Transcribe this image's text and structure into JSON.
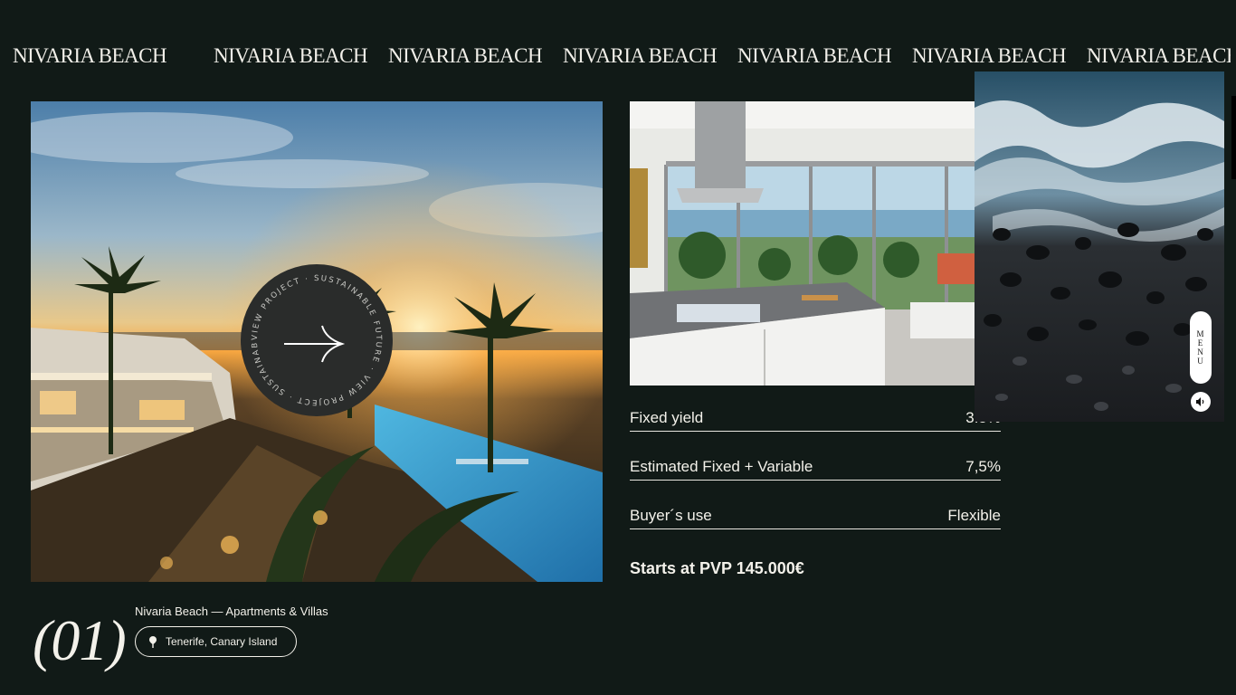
{
  "marquee": {
    "text": "NIVARIA BEACH"
  },
  "hero": {
    "badge_text": "VIEW PROJECT · SUSTAINABLE FUTURE · VIEW PROJECT · SUSTAINABLE FUTURE ·",
    "badge_icon": "arrow-right-icon"
  },
  "project": {
    "index": "(01)",
    "title": "Nivaria Beach — Apartments & Villas",
    "location": "Tenerife, Canary Island",
    "location_icon": "location-pin-icon"
  },
  "specs": [
    {
      "label": "Fixed yield",
      "value": "3.5%"
    },
    {
      "label": "Estimated Fixed + Variable",
      "value": "7,5%"
    },
    {
      "label": "Buyer´s use",
      "value": "Flexible"
    }
  ],
  "price": "Starts at PVP 145.000€",
  "menu": {
    "letters": [
      "M",
      "E",
      "N",
      "U"
    ],
    "sound_icon": "speaker-icon"
  },
  "colors": {
    "background": "#111a17",
    "text": "#f3f1ea",
    "badge": "#2a2c2b"
  }
}
